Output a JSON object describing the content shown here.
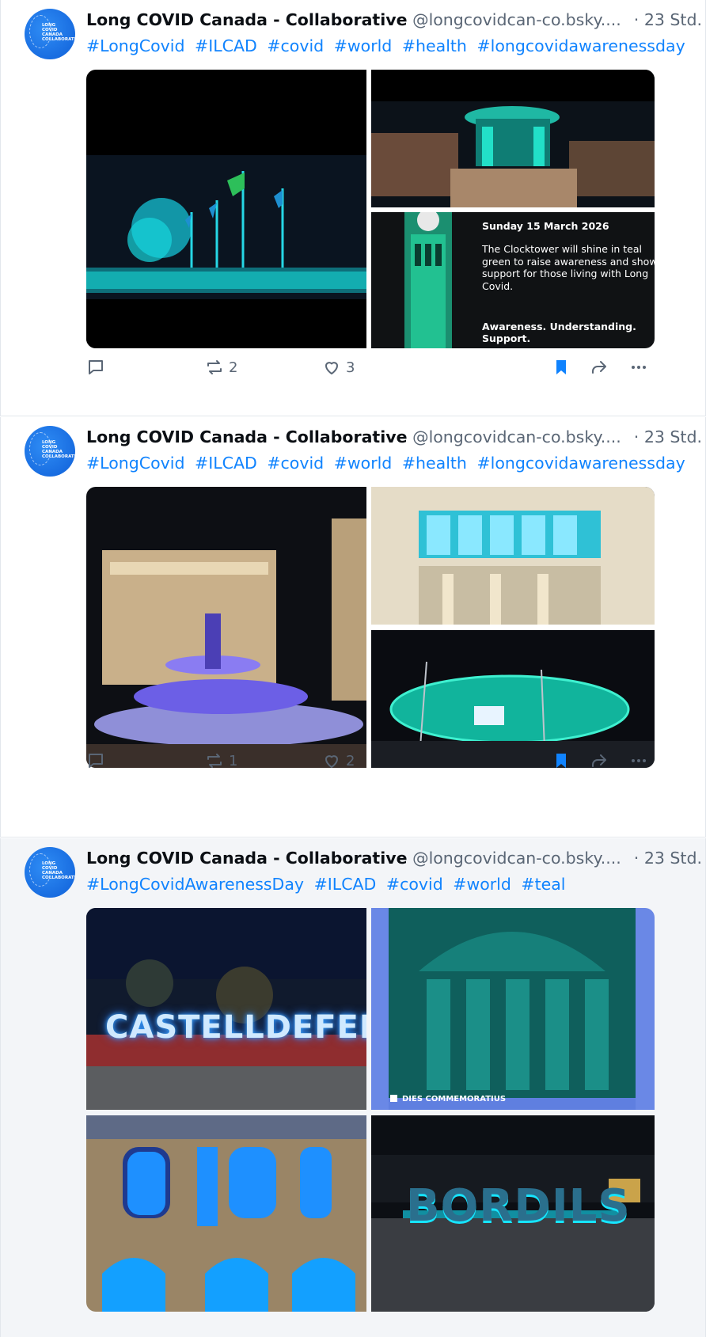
{
  "posts": [
    {
      "author": {
        "name": "Long COVID Canada - Collaborative",
        "handle": "@longcovidcan-co.bsky....",
        "time": "· 23 Std.",
        "avatar_text": [
          "LONG COVID",
          "CANADA",
          "COLLABORATIVE"
        ]
      },
      "tags": [
        "#LongCovid",
        "#ILCAD",
        "#covid",
        "#world",
        "#health",
        "#longcovidawarenessday"
      ],
      "images": {
        "clocktower": {
          "date": "Sunday 15 March 2026",
          "body": "The Clocktower will shine in teal green to raise awareness and show support for those living with Long Covid.",
          "tagline": "Awareness. Understanding. Support."
        }
      },
      "stats": {
        "reposts": "2",
        "likes": "3"
      }
    },
    {
      "author": {
        "name": "Long COVID Canada - Collaborative",
        "handle": "@longcovidcan-co.bsky....",
        "time": "· 23 Std.",
        "avatar_text": [
          "LONG COVID",
          "CANADA",
          "COLLABORATIVE"
        ]
      },
      "tags": [
        "#LongCovid",
        "#ILCAD",
        "#covid",
        "#world",
        "#health",
        "#longcovidawarenessday"
      ],
      "stats": {
        "reposts": "1",
        "likes": "2"
      }
    },
    {
      "author": {
        "name": "Long COVID Canada - Collaborative",
        "handle": "@longcovidcan-co.bsky....",
        "time": "· 23 Std.",
        "avatar_text": [
          "LONG COVID",
          "CANADA",
          "COLLABORATIVE"
        ]
      },
      "tags": [
        "#LongCovidAwarenessDay",
        "#ILCAD",
        "#covid",
        "#world",
        "#teal"
      ],
      "images": {
        "castelldefels_sign": "CASTELLDEFELS",
        "building_caption": "DIES COMMEMORATIUS",
        "bordils_sign": "BORDILS"
      }
    }
  ],
  "icons": {
    "reply": "speech-bubble-icon",
    "repost": "repost-arrows-icon",
    "like": "heart-outline-icon",
    "bookmark": "bookmark-filled-icon",
    "share": "share-arrow-icon",
    "more": "three-dots-icon"
  },
  "colors": {
    "hashtag": "#1083fe",
    "bookmark": "#1083fe",
    "muted": "#5a6675",
    "teal_light": "#16e5d4"
  }
}
